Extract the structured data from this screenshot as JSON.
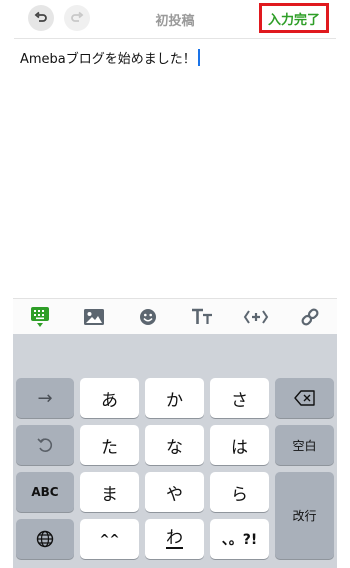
{
  "header": {
    "title": "初投稿",
    "done_label": "入力完了",
    "undo_icon": "undo-icon",
    "redo_icon": "redo-icon"
  },
  "editor": {
    "text": "Amebaブログを始めました！"
  },
  "toolbar": {
    "items": [
      "keyboard-icon",
      "image-icon",
      "emoji-icon",
      "text-size-icon",
      "embed-icon",
      "link-icon"
    ],
    "active_color": "#2e9e27"
  },
  "keyboard": {
    "row1": [
      "あ",
      "か",
      "さ"
    ],
    "row2": [
      "た",
      "な",
      "は"
    ],
    "row3": [
      "ま",
      "や",
      "ら"
    ],
    "row4_left": "^^",
    "row4_wa": "わ",
    "row4_punct": "、。?!",
    "abc_label": "ABC",
    "space_label": "空白",
    "enter_label": "改行",
    "arrow_label": "→"
  }
}
